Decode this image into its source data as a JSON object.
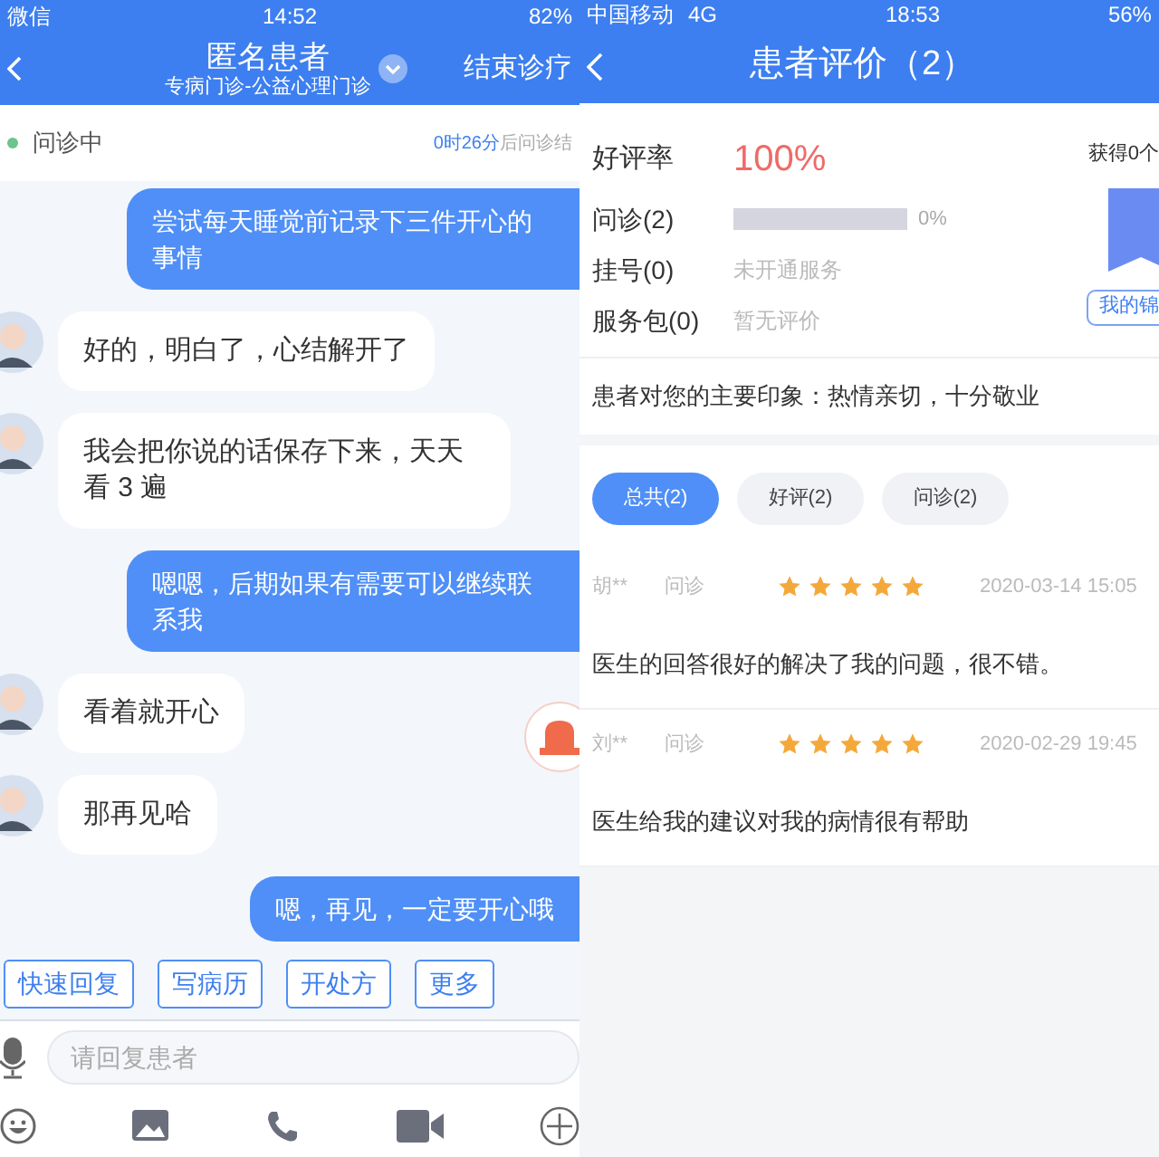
{
  "chat_screen": {
    "status_bar": {
      "carrier": "微信",
      "time": "14:52",
      "battery": "82%"
    },
    "header": {
      "title": "匿名患者",
      "subtitle": "专病门诊-公益心理门诊",
      "action": "结束诊疗"
    },
    "status": {
      "label": "问诊中",
      "remaining": "0时26分",
      "remaining_suffix": "后问诊结"
    },
    "messages": [
      {
        "kind": "sent",
        "text": "尝试每天睡觉前记录下三件开心的事情"
      },
      {
        "kind": "received",
        "text": "好的，明白了，心结解开了"
      },
      {
        "kind": "received",
        "text": "我会把你说的话保存下来，天天看 3 遍"
      },
      {
        "kind": "sent",
        "text": "嗯嗯，后期如果有需要可以继续联系我"
      },
      {
        "kind": "received",
        "text": "看着就开心"
      },
      {
        "kind": "received",
        "text": "那再见哈"
      },
      {
        "kind": "sent",
        "text": "嗯，再见，一定要开心哦"
      }
    ],
    "quick_actions": [
      "快速回复",
      "写病历",
      "开处方",
      "更多"
    ],
    "input": {
      "placeholder": "请回复患者"
    }
  },
  "review_screen": {
    "status_bar": {
      "carrier": "中国移动",
      "network": "4G",
      "time": "18:53",
      "battery": "56%"
    },
    "header": {
      "title": "患者评价（2）"
    },
    "summary": {
      "rate_label": "好评率",
      "rate": "100%",
      "rows": [
        {
          "label": "问诊(2)",
          "kind": "bar",
          "level": 0,
          "reading": "0%"
        },
        {
          "label": "挂号(0)",
          "kind": "note",
          "note": "未开通服务"
        },
        {
          "label": "服务包(0)",
          "kind": "note",
          "note": "暂无评价"
        }
      ],
      "badge_text": "获得0个",
      "badge_button": "我的锦"
    },
    "impression": "患者对您的主要印象：热情亲切，十分敬业",
    "filters": [
      {
        "label": "总共(2)",
        "selected": true
      },
      {
        "label": "好评(2)",
        "selected": false
      },
      {
        "label": "问诊(2)",
        "selected": false
      }
    ],
    "reviews": [
      {
        "name": "胡**",
        "type": "问诊",
        "stars": 5,
        "time": "2020-03-14 15:05",
        "text": "医生的回答很好的解决了我的问题，很不错。"
      },
      {
        "name": "刘**",
        "type": "问诊",
        "stars": 5,
        "time": "2020-02-29 19:45",
        "text": "医生给我的建议对我的病情很有帮助"
      }
    ]
  }
}
